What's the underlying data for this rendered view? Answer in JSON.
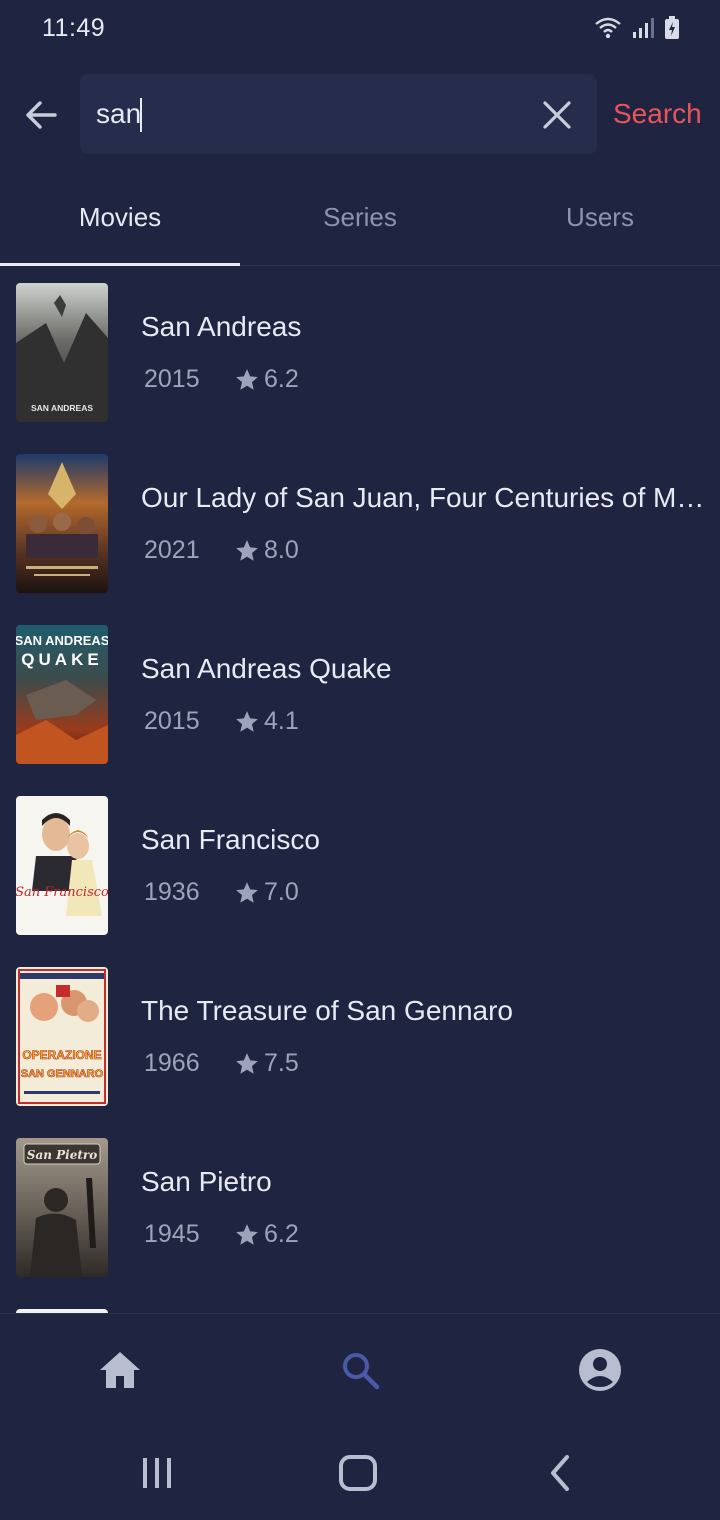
{
  "status_bar": {
    "time": "11:49"
  },
  "search": {
    "query": "san",
    "action_label": "Search"
  },
  "tabs": [
    {
      "label": "Movies",
      "active": true
    },
    {
      "label": "Series",
      "active": false
    },
    {
      "label": "Users",
      "active": false
    }
  ],
  "results": [
    {
      "title": "San Andreas",
      "year": "2015",
      "rating": "6.2"
    },
    {
      "title": "Our Lady of San Juan, Four Centuries of Miracles",
      "year": "2021",
      "rating": "8.0"
    },
    {
      "title": "San Andreas Quake",
      "year": "2015",
      "rating": "4.1"
    },
    {
      "title": "San Francisco",
      "year": "1936",
      "rating": "7.0"
    },
    {
      "title": "The Treasure of San Gennaro",
      "year": "1966",
      "rating": "7.5"
    },
    {
      "title": "San Pietro",
      "year": "1945",
      "rating": "6.2"
    }
  ],
  "poster_text": {
    "p1": "SAN ANDREAS",
    "p3a": "SAN ANDREAS",
    "p3b": "QUAKE",
    "p4": "San Francisco",
    "p5a": "OPERAZIONE",
    "p5b": "SAN GENNARO",
    "p6": "San Pietro"
  },
  "bottom_nav": [
    {
      "icon": "home-icon",
      "active": false
    },
    {
      "icon": "search-icon",
      "active": true
    },
    {
      "icon": "account-icon",
      "active": false
    }
  ],
  "colors": {
    "background": "#1f2440",
    "search_field": "#262c4b",
    "accent_red": "#e8545d",
    "active_nav": "#4a5aa8",
    "inactive_nav": "#b8bdd0"
  }
}
